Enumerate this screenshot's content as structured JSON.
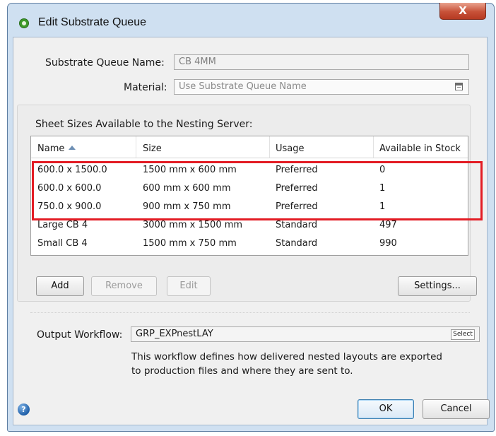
{
  "window": {
    "title": "Edit Substrate Queue",
    "close_glyph": "X"
  },
  "form": {
    "name_label": "Substrate Queue Name:",
    "name_value": "CB 4MM",
    "material_label": "Material:",
    "material_placeholder": "Use Substrate Queue Name"
  },
  "sheets": {
    "group_label": "Sheet Sizes Available to the Nesting Server:",
    "columns": [
      "Name",
      "Size",
      "Usage",
      "Available in Stock"
    ],
    "sort_column": "Name",
    "rows": [
      {
        "name": "600.0 x 1500.0",
        "size": "1500 mm x 600 mm",
        "usage": "Preferred",
        "stock": "0"
      },
      {
        "name": "600.0 x 600.0",
        "size": "600 mm x 600 mm",
        "usage": "Preferred",
        "stock": "1"
      },
      {
        "name": "750.0 x 900.0",
        "size": "900 mm x 750 mm",
        "usage": "Preferred",
        "stock": "1"
      },
      {
        "name": "Large CB 4",
        "size": "3000 mm x 1500 mm",
        "usage": "Standard",
        "stock": "497"
      },
      {
        "name": "Small CB 4",
        "size": "1500 mm x 750 mm",
        "usage": "Standard",
        "stock": "990"
      }
    ],
    "buttons": {
      "add": "Add",
      "remove": "Remove",
      "edit": "Edit",
      "settings": "Settings..."
    },
    "highlight_color": "#e31c24"
  },
  "output": {
    "label": "Output Workflow:",
    "value": "GRP_EXPnestLAY",
    "select_label": "Select",
    "description_line1": "This workflow defines how delivered nested layouts are exported",
    "description_line2": "to production files and where they are sent to."
  },
  "footer": {
    "help_glyph": "?",
    "ok": "OK",
    "cancel": "Cancel"
  }
}
